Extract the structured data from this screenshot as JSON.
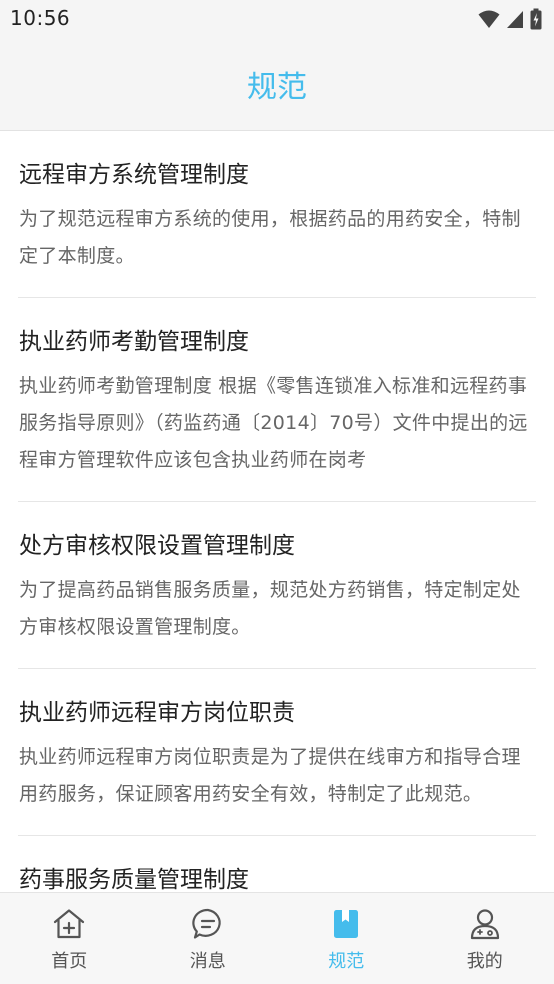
{
  "status_bar": {
    "time": "10:56"
  },
  "header": {
    "title": "规范"
  },
  "items": [
    {
      "title": "远程审方系统管理制度",
      "desc": "为了规范远程审方系统的使用，根据药品的用药安全，特制定了本制度。"
    },
    {
      "title": "执业药师考勤管理制度",
      "desc": "执业药师考勤管理制度 根据《零售连锁准入标准和远程药事服务指导原则》（药监药通〔2014〕70号）文件中提出的远程审方管理软件应该包含执业药师在岗考"
    },
    {
      "title": "处方审核权限设置管理制度",
      "desc": "为了提高药品销售服务质量，规范处方药销售，特定制定处方审核权限设置管理制度。"
    },
    {
      "title": "执业药师远程审方岗位职责",
      "desc": "执业药师远程审方岗位职责是为了提供在线审方和指导合理用药服务，保证顾客用药安全有效，特制定了此规范。"
    },
    {
      "title": "药事服务质量管理制度",
      "desc": ""
    }
  ],
  "nav": {
    "tabs": [
      {
        "label": "首页",
        "icon": "home-icon"
      },
      {
        "label": "消息",
        "icon": "message-icon"
      },
      {
        "label": "规范",
        "icon": "bookmark-book-icon",
        "active": true
      },
      {
        "label": "我的",
        "icon": "profile-icon"
      }
    ]
  },
  "colors": {
    "accent": "#45bcec",
    "title_text": "#222222",
    "desc_text": "#666666",
    "header_bg": "#f5f5f5"
  }
}
